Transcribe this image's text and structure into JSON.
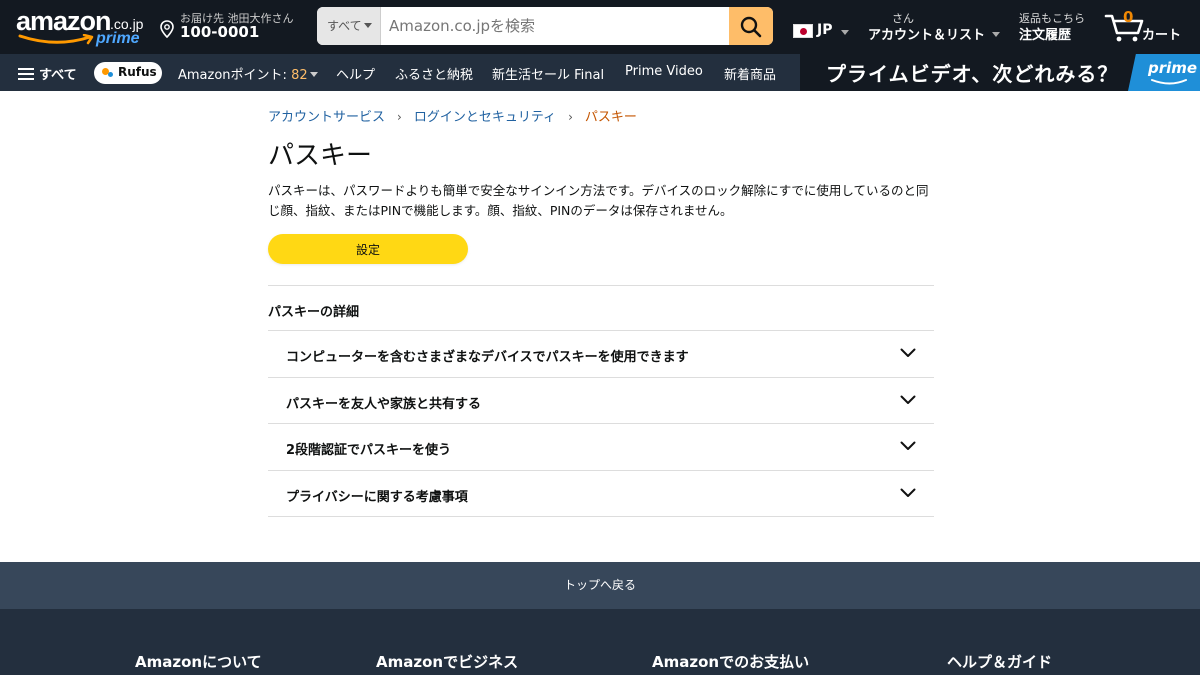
{
  "header": {
    "logo_word": "amazon",
    "logo_tld": ".co.jp",
    "logo_prime": "prime",
    "deliver_line1": "お届け先 池田大作さん",
    "deliver_postal": "100-0001",
    "search_category": "すべて",
    "search_placeholder": "Amazon.co.jpを検索",
    "language_code": "JP",
    "account_greeting": "さん",
    "account_label": "アカウント＆リスト",
    "returns_line1": "返品もこちら",
    "returns_line2": "注文履歴",
    "cart_count": "0",
    "cart_label": "カート"
  },
  "nav": {
    "all_label": "すべて",
    "rufus_label": "Rufus",
    "points_label": "Amazonポイント: ",
    "points_value": "82",
    "items": [
      "ヘルプ",
      "ふるさと納税",
      "新生活セール Final",
      "Prime Video",
      "新着商品"
    ],
    "banner_text": "プライムビデオ、次どれみる？",
    "banner_prime": "prime"
  },
  "breadcrumb": {
    "items": [
      "アカウントサービス",
      "ログインとセキュリティ",
      "パスキー"
    ],
    "separator": "›"
  },
  "page": {
    "title": "パスキー",
    "description": "パスキーは、パスワードよりも簡単で安全なサインイン方法です。デバイスのロック解除にすでに使用しているのと同じ顔、指紋、またはPINで機能します。顔、指紋、PINのデータは保存されません。",
    "setup_button": "設定",
    "details_heading": "パスキーの詳細",
    "accordion": [
      "コンピューターを含むさまざまなデバイスでパスキーを使用できます",
      "パスキーを友人や家族と共有する",
      "2段階認証でパスキーを使う",
      "プライバシーに関する考慮事項"
    ]
  },
  "footer": {
    "back_to_top": "トップへ戻る",
    "columns": [
      "Amazonについて",
      "Amazonでビジネス",
      "Amazonでのお支払い",
      "ヘルプ＆ガイド"
    ]
  },
  "colors": {
    "header_bg": "#131921",
    "nav_bg": "#232f3e",
    "accent_button": "#ffd814",
    "search_button": "#febd69",
    "link": "#2162a1",
    "current_crumb": "#c45500",
    "backtop_bg": "#37475a"
  },
  "icons": [
    "location-pin-icon",
    "search-icon",
    "chevron-down-icon",
    "cart-icon",
    "menu-icon",
    "japan-flag-icon"
  ]
}
